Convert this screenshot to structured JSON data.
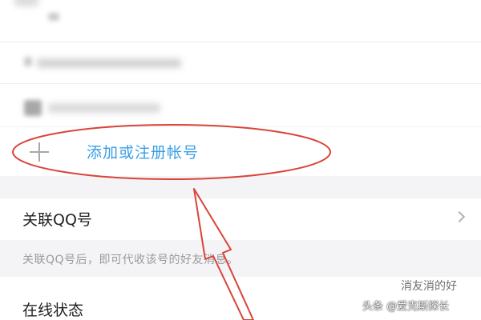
{
  "add_account": {
    "label": "添加或注册帐号",
    "icon": "plus-icon"
  },
  "link_qq": {
    "label": "关联QQ号",
    "hint": "关联QQ号后，即可代收该号的好友消息。",
    "icon": "chevron-right-icon"
  },
  "online_status": {
    "label": "在线状态",
    "overlap_text": "消友消的好"
  },
  "watermark": {
    "text": "头条 @爱克斯探长"
  },
  "colors": {
    "accent": "#3a9ee4",
    "annotation": "#d9433a"
  }
}
